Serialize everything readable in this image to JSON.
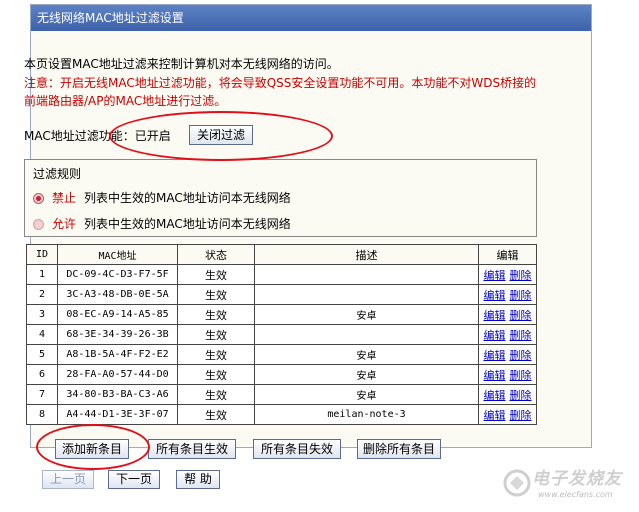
{
  "panel": {
    "title": "无线网络MAC地址过滤设置",
    "description": "本页设置MAC地址过滤来控制计算机对本无线网络的访问。",
    "warning": "注意：开启无线MAC地址过滤功能，将会导致QSS安全设置功能不可用。本功能不对WDS桥接的前端路由器/AP的MAC地址进行过滤。"
  },
  "filter_status": {
    "label": "MAC地址过滤功能：",
    "value": "已开启",
    "toggle_button": "关闭过滤"
  },
  "rules": {
    "title": "过滤规则",
    "options": [
      {
        "key": "禁止",
        "text": "列表中生效的MAC地址访问本无线网络",
        "selected": true
      },
      {
        "key": "允许",
        "text": "列表中生效的MAC地址访问本无线网络",
        "selected": false
      }
    ]
  },
  "table": {
    "headers": [
      "ID",
      "MAC地址",
      "状态",
      "描述",
      "编辑"
    ],
    "edit_label": "编辑",
    "delete_label": "删除",
    "rows": [
      {
        "id": "1",
        "mac": "DC-09-4C-D3-F7-5F",
        "status": "生效",
        "desc": ""
      },
      {
        "id": "2",
        "mac": "3C-A3-48-DB-0E-5A",
        "status": "生效",
        "desc": ""
      },
      {
        "id": "3",
        "mac": "08-EC-A9-14-A5-85",
        "status": "生效",
        "desc": "安卓"
      },
      {
        "id": "4",
        "mac": "68-3E-34-39-26-3B",
        "status": "生效",
        "desc": ""
      },
      {
        "id": "5",
        "mac": "A8-1B-5A-4F-F2-E2",
        "status": "生效",
        "desc": "安卓"
      },
      {
        "id": "6",
        "mac": "28-FA-A0-57-44-D0",
        "status": "生效",
        "desc": "安卓"
      },
      {
        "id": "7",
        "mac": "34-80-B3-BA-C3-A6",
        "status": "生效",
        "desc": "安卓"
      },
      {
        "id": "8",
        "mac": "A4-44-D1-3E-3F-07",
        "status": "生效",
        "desc": "meilan-note-3"
      }
    ]
  },
  "actions": {
    "add": "添加新条目",
    "enable_all": "所有条目生效",
    "disable_all": "所有条目失效",
    "delete_all": "删除所有条目"
  },
  "nav": {
    "prev": "上一页",
    "next": "下一页",
    "help": "帮 助"
  },
  "watermark": {
    "brand": "电子发烧友",
    "url": "www.elecfans.com"
  },
  "colors": {
    "title_bar": "#4a6eb5",
    "warning": "#cc0000",
    "annotation": "#e0101a"
  }
}
